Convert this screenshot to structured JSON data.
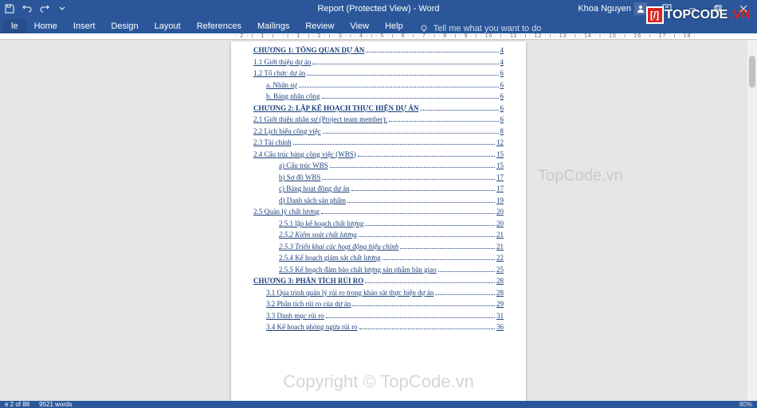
{
  "titlebar": {
    "title": "Report (Protected View) - Word",
    "user": "Khoa Nguyen"
  },
  "ribbon": {
    "tabs": [
      "le",
      "Home",
      "Insert",
      "Design",
      "Layout",
      "References",
      "Mailings",
      "Review",
      "View",
      "Help"
    ],
    "tellme": "Tell me what you want to do"
  },
  "ruler": "· 2 · ı · 1 · ı ·  · ı · 1 · ı · 2 · ı · 3 · ı · 4 · ı · 5 · ı · 6 · ı · 7 · ı · 8 · ı · 9 · ı · 10 · ı · 11 · ı · 12 · ı · 13 · ı · 14 · ı · 15 · ı · 16 · ı · 17 · ı · 18 ·",
  "toc": [
    {
      "label": "CHƯƠNG 1: TỔNG QUAN DỰ ÁN",
      "page": "4",
      "type": "chapter",
      "indent": 0
    },
    {
      "label": "1.1 Giới thiệu dự án",
      "page": "4",
      "indent": 0
    },
    {
      "label": "1.2 Tổ chức dự án",
      "page": "6",
      "indent": 0
    },
    {
      "label": "a. Nhân sự",
      "page": "6",
      "indent": 1
    },
    {
      "label": "b. Bảng phân công",
      "page": "6",
      "indent": 1
    },
    {
      "label": "CHƯƠNG 2: LẬP KẾ HOẠCH THỰC HIỆN DỰ ÁN",
      "page": "6",
      "type": "chapter",
      "indent": 0
    },
    {
      "label": "2.1 Giới thiệu nhân sự (Project team member):",
      "page": "6",
      "indent": 0
    },
    {
      "label": "2.2 Lịch biểu công việc",
      "page": "8",
      "indent": 0
    },
    {
      "label": "2.3 Tài chính",
      "page": "12",
      "indent": 0
    },
    {
      "label": "2.4 Cấu trúc bảng công việc (WBS)",
      "page": "15",
      "indent": 0
    },
    {
      "label": "a) Cấu trúc WBS",
      "page": "15",
      "indent": 2
    },
    {
      "label": "b) Sơ đồ WBS",
      "page": "17",
      "indent": 2
    },
    {
      "label": "c) Bảng hoạt động dự án",
      "page": "17",
      "indent": 2
    },
    {
      "label": "d) Danh sách sản phẩm",
      "page": "19",
      "indent": 2
    },
    {
      "label": "2.5 Quản lý chất lượng",
      "page": "20",
      "indent": 0
    },
    {
      "label": "2.5.1 lập kế hoạch chất lượng",
      "page": "20",
      "indent": 2
    },
    {
      "label": "2.5.2 Kiểm soát chất lượng",
      "page": "21",
      "type": "italic",
      "indent": 2
    },
    {
      "label": "2.5.3 Triển khai các hoạt động hiệu chỉnh",
      "page": "21",
      "type": "italic",
      "indent": 2
    },
    {
      "label": "2.5.4 Kế hoạch giám sát chất lượng",
      "page": "22",
      "indent": 2
    },
    {
      "label": "2.5.5 Kế hoạch đảm bảo chất lượng sản phẩm bàn giao",
      "page": "25",
      "indent": 2
    },
    {
      "label": "CHƯƠNG 3: PHÂN TÍCH RỦI RO",
      "page": "28",
      "type": "chapter",
      "indent": 0
    },
    {
      "label": "3.1 Qúa trình quản lý rủi ro trong khảo sát thực hiện dự án",
      "page": "28",
      "indent": 1
    },
    {
      "label": "3.2 Phân tích rủi ro của dự án",
      "page": "29",
      "indent": 1
    },
    {
      "label": "3.3 Danh mục rủi ro",
      "page": "31",
      "indent": 1
    },
    {
      "label": "3.4 Kế hoạch phòng ngừa rủi ro",
      "page": "36",
      "indent": 1
    }
  ],
  "statusbar": {
    "page": "e 2 of 88",
    "words": "9521 words",
    "zoom": "80%"
  },
  "watermarks": {
    "logo_full": "TOPCODE",
    "logo_red": ".VN",
    "center": "TopCode.vn",
    "bottom": "Copyright © TopCode.vn"
  }
}
